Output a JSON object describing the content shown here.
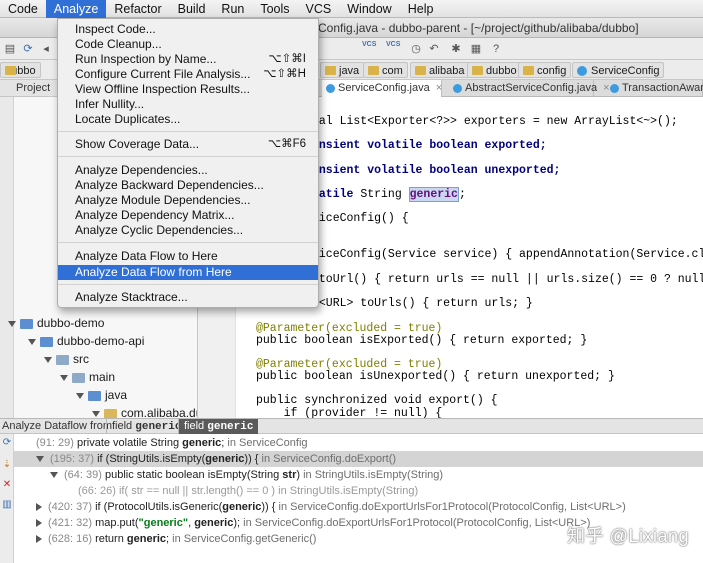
{
  "menubar": {
    "items": [
      "Code",
      "Analyze",
      "Refactor",
      "Build",
      "Run",
      "Tools",
      "VCS",
      "Window",
      "Help"
    ],
    "active": "Analyze"
  },
  "window": {
    "title": "Config.java - dubbo-parent - [~/project/github/alibaba/dubbo]"
  },
  "toolbar": {
    "vcs_label": "VCS"
  },
  "breadcrumb": [
    "dubbo",
    "java",
    "com",
    "alibaba",
    "dubbo",
    "config",
    "ServiceConfig"
  ],
  "project_panel": {
    "header": "Project",
    "tree": [
      "dubbo-demo",
      "dubbo-demo-api",
      "src",
      "main",
      "java",
      "com.alibaba.du"
    ]
  },
  "tabs": [
    "ServiceConfig.java",
    "AbstractServiceConfig.java",
    "TransactionAwar"
  ],
  "code_lines": [
    "nal List<Exporter<?>> exporters = new ArrayList<~>();",
    "ansient volatile boolean exported;",
    "ansient volatile boolean unexported;",
    "latile String generic;",
    "viceConfig() {",
    "viceConfig(Service service) { appendAnnotation(Service.class, servic",
    " toUrl() { return urls == null || urls.size() == 0 ? null : urls.ite",
    "t<URL> toUrls() { return urls; }",
    "@Parameter(excluded = true)",
    "public boolean isExported() { return exported; }",
    "@Parameter(excluded = true)",
    "public boolean isUnexported() { return unexported; }",
    "public synchronized void export() {",
    "    if (provider != null) {"
  ],
  "analyze_menu": {
    "items": [
      {
        "label": "Inspect Code...",
        "shortcut": ""
      },
      {
        "label": "Code Cleanup...",
        "shortcut": ""
      },
      {
        "label": "Run Inspection by Name...",
        "shortcut": "⌥⇧⌘I"
      },
      {
        "label": "Configure Current File Analysis...",
        "shortcut": "⌥⇧⌘H"
      },
      {
        "label": "View Offline Inspection Results...",
        "shortcut": ""
      },
      {
        "label": "Infer Nullity...",
        "shortcut": ""
      },
      {
        "label": "Locate Duplicates...",
        "shortcut": ""
      },
      {
        "label": "Show Coverage Data...",
        "shortcut": "⌥⌘F6"
      },
      {
        "label": "Analyze Dependencies...",
        "shortcut": ""
      },
      {
        "label": "Analyze Backward Dependencies...",
        "shortcut": ""
      },
      {
        "label": "Analyze Module Dependencies...",
        "shortcut": ""
      },
      {
        "label": "Analyze Dependency Matrix...",
        "shortcut": ""
      },
      {
        "label": "Analyze Cyclic Dependencies...",
        "shortcut": ""
      },
      {
        "label": "Analyze Data Flow to Here",
        "shortcut": ""
      },
      {
        "label": "Analyze Data Flow from Here",
        "shortcut": ""
      },
      {
        "label": "Analyze Stacktrace...",
        "shortcut": ""
      }
    ],
    "selected": "Analyze Data Flow from Here"
  },
  "dataflow": {
    "label": "Analyze Dataflow from:",
    "tabs": [
      {
        "prefix": "field",
        "name": "generic"
      },
      {
        "prefix": "field",
        "name": "generic"
      }
    ],
    "rows": [
      {
        "ln": "(91: 29)",
        "pre": "private volatile String ",
        "strong": "generic",
        "post": ";",
        "loc": "in ServiceConfig"
      },
      {
        "ln": "(195: 37)",
        "pre": "if (StringUtils.isEmpty(",
        "strong": "generic",
        "post": ")) {",
        "loc": "in ServiceConfig.doExport()"
      },
      {
        "ln": "(64: 39)",
        "pre": "public static boolean isEmpty(String ",
        "strong": "str",
        "post": ")",
        "loc": "in StringUtils.isEmpty(String)"
      },
      {
        "ln": "(66: 26)",
        "pre": "if( str == null || str.length() == 0 )",
        "strong": "",
        "post": "",
        "loc": "in StringUtils.isEmpty(String)"
      },
      {
        "ln": "(420: 37)",
        "pre": "if (ProtocolUtils.isGeneric(",
        "strong": "generic",
        "post": ")) {",
        "loc": "in ServiceConfig.doExportUrlsFor1Protocol(ProtocolConfig, List<URL>)"
      },
      {
        "ln": "(421: 32)",
        "pre": "map.put(",
        "str": "\"generic\"",
        "mid": ", ",
        "strong": "generic",
        "post": ");",
        "loc": "in ServiceConfig.doExportUrlsFor1Protocol(ProtocolConfig, List<URL>)"
      },
      {
        "ln": "(628: 16)",
        "pre": "return ",
        "strong": "generic",
        "post": ";",
        "loc": "in ServiceConfig.getGeneric()"
      }
    ]
  },
  "watermark": "知乎 @Lixiang"
}
